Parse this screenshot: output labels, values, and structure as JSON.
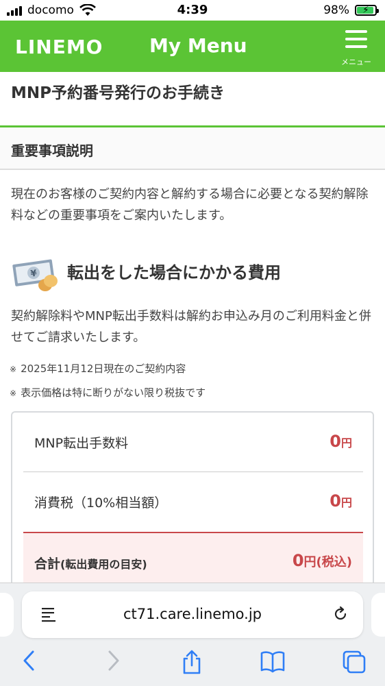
{
  "status_bar": {
    "carrier": "docomo",
    "time": "4:39",
    "battery": "98%"
  },
  "header": {
    "logo": "LINEMO",
    "title": "My Menu",
    "menu_label": "メニュー"
  },
  "page": {
    "title": "MNP予約番号発行のお手続き",
    "section_title": "重要事項説明",
    "intro": "現在のお客様のご契約内容と解約する場合に必要となる契約解除料などの重要事項をご案内いたします。",
    "cost_title": "転出をした場合にかかる費用",
    "cost_description": "契約解除料やMNP転出手数料は解約お申込み月のご利用料金と併せてご請求いたします。",
    "notes": [
      "2025年11月12日現在のご契約内容",
      "表示価格は特に断りがない限り税抜です"
    ],
    "note_mark": "※"
  },
  "fees": [
    {
      "label": "MNP転出手数料",
      "amount": "0",
      "unit": "円"
    },
    {
      "label": "消費税（10%相当額）",
      "amount": "0",
      "unit": "円"
    }
  ],
  "total": {
    "label": "合計",
    "label_sub": "(転出費用の目安)",
    "amount": "0",
    "unit": "円(税込)"
  },
  "browser": {
    "url": "ct71.care.linemo.jp"
  },
  "colors": {
    "brand_green": "#5bc435",
    "price_red": "#c8474a",
    "total_bg": "#fdeeee"
  }
}
